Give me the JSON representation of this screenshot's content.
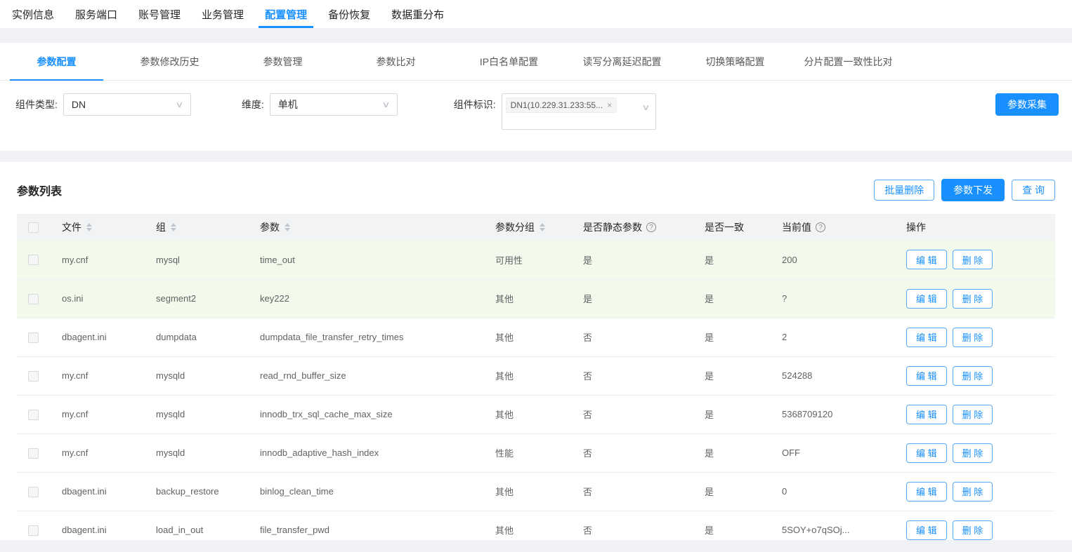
{
  "colors": {
    "accent": "#1890ff",
    "row_highlight": "#f4faeb"
  },
  "top_nav": {
    "items": [
      {
        "label": "实例信息",
        "active": false
      },
      {
        "label": "服务端口",
        "active": false
      },
      {
        "label": "账号管理",
        "active": false
      },
      {
        "label": "业务管理",
        "active": false
      },
      {
        "label": "配置管理",
        "active": true
      },
      {
        "label": "备份恢复",
        "active": false
      },
      {
        "label": "数据重分布",
        "active": false
      }
    ]
  },
  "sub_tabs": {
    "items": [
      {
        "label": "参数配置",
        "active": true
      },
      {
        "label": "参数修改历史",
        "active": false
      },
      {
        "label": "参数管理",
        "active": false
      },
      {
        "label": "参数比对",
        "active": false
      },
      {
        "label": "IP白名单配置",
        "active": false
      },
      {
        "label": "读写分离延迟配置",
        "active": false
      },
      {
        "label": "切换策略配置",
        "active": false
      },
      {
        "label": "分片配置一致性比对",
        "active": false
      }
    ]
  },
  "filters": {
    "component_type": {
      "label": "组件类型:",
      "value": "DN"
    },
    "dimension": {
      "label": "维度:",
      "value": "单机"
    },
    "component_id": {
      "label": "组件标识:",
      "tag": "DN1(10.229.31.233:55...",
      "remove_icon": "×"
    },
    "collect_button": "参数采集"
  },
  "param_list": {
    "title": "参数列表",
    "buttons": {
      "batch_delete": "批量删除",
      "distribute": "参数下发",
      "query": "查 询"
    },
    "row_actions": {
      "edit": "编 辑",
      "delete": "删 除"
    },
    "table": {
      "headers": [
        {
          "key": "check",
          "type": "checkbox",
          "label": ""
        },
        {
          "key": "file",
          "label": "文件",
          "sortable": true
        },
        {
          "key": "group",
          "label": "组",
          "sortable": true
        },
        {
          "key": "param",
          "label": "参数",
          "sortable": true
        },
        {
          "key": "param_group",
          "label": "参数分组",
          "sortable": true
        },
        {
          "key": "is_static",
          "label": "是否静态参数",
          "info": true
        },
        {
          "key": "is_consistent",
          "label": "是否一致"
        },
        {
          "key": "current_value",
          "label": "当前值",
          "info": true
        },
        {
          "key": "ops",
          "label": "操作"
        }
      ],
      "rows": [
        {
          "file": "my.cnf",
          "group": "mysql",
          "param": "time_out",
          "param_group": "可用性",
          "is_static": "是",
          "is_consistent": "是",
          "current_value": "200",
          "highlighted": true
        },
        {
          "file": "os.ini",
          "group": "segment2",
          "param": "key222",
          "param_group": "其他",
          "is_static": "是",
          "is_consistent": "是",
          "current_value": "?",
          "highlighted": true
        },
        {
          "file": "dbagent.ini",
          "group": "dumpdata",
          "param": "dumpdata_file_transfer_retry_times",
          "param_group": "其他",
          "is_static": "否",
          "is_consistent": "是",
          "current_value": "2",
          "highlighted": false
        },
        {
          "file": "my.cnf",
          "group": "mysqld",
          "param": "read_rnd_buffer_size",
          "param_group": "其他",
          "is_static": "否",
          "is_consistent": "是",
          "current_value": "524288",
          "highlighted": false
        },
        {
          "file": "my.cnf",
          "group": "mysqld",
          "param": "innodb_trx_sql_cache_max_size",
          "param_group": "其他",
          "is_static": "否",
          "is_consistent": "是",
          "current_value": "5368709120",
          "highlighted": false
        },
        {
          "file": "my.cnf",
          "group": "mysqld",
          "param": "innodb_adaptive_hash_index",
          "param_group": "性能",
          "is_static": "否",
          "is_consistent": "是",
          "current_value": "OFF",
          "highlighted": false
        },
        {
          "file": "dbagent.ini",
          "group": "backup_restore",
          "param": "binlog_clean_time",
          "param_group": "其他",
          "is_static": "否",
          "is_consistent": "是",
          "current_value": "0",
          "highlighted": false
        },
        {
          "file": "dbagent.ini",
          "group": "load_in_out",
          "param": "file_transfer_pwd",
          "param_group": "其他",
          "is_static": "否",
          "is_consistent": "是",
          "current_value": "5SOY+o7qSOj...",
          "highlighted": false
        }
      ]
    }
  }
}
